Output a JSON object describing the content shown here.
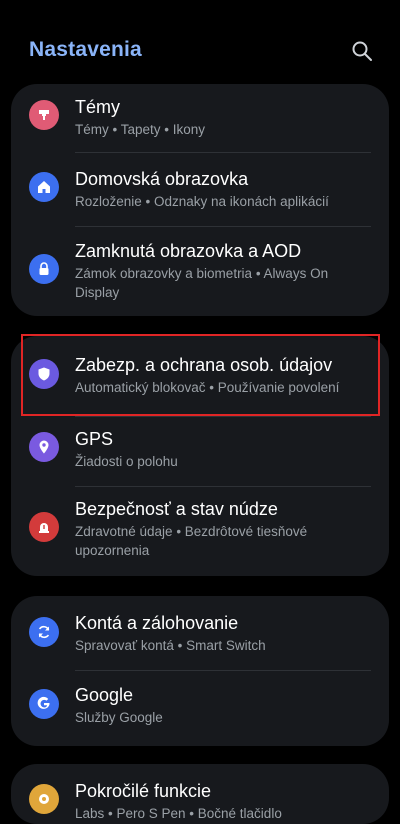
{
  "header": {
    "title": "Nastavenia",
    "search_icon": "search-icon"
  },
  "colors": {
    "accent": "#8ab4f8",
    "highlight": "#e02525"
  },
  "cards": [
    {
      "items": [
        {
          "title": "Témy",
          "subtitle": "Témy  •  Tapety  •  Ikony",
          "icon": "palette-icon",
          "color": "#e05b75"
        },
        {
          "title": "Domovská obrazovka",
          "subtitle": "Rozloženie  •  Odznaky na ikonách aplikácií",
          "icon": "home-icon",
          "color": "#3c6ff0"
        },
        {
          "title": "Zamknutá obrazovka a AOD",
          "subtitle": "Zámok obrazovky a biometria  •  Always On Display",
          "icon": "lock-icon",
          "color": "#3c6ff0"
        }
      ]
    },
    {
      "items": [
        {
          "title": "Zabezp. a ochrana osob. údajov",
          "subtitle": "Automatický blokovač  •  Používanie povolení",
          "icon": "shield-icon",
          "color": "#6b5ae0"
        },
        {
          "title": "GPS",
          "subtitle": "Žiadosti o polohu",
          "icon": "location-pin-icon",
          "color": "#7a5ae0"
        },
        {
          "title": "Bezpečnosť a stav núdze",
          "subtitle": "Zdravotné údaje  •  Bezdrôtové tiesňové upozornenia",
          "icon": "emergency-icon",
          "color": "#d33b3b"
        }
      ]
    },
    {
      "items": [
        {
          "title": "Kontá a zálohovanie",
          "subtitle": "Spravovať kontá  •  Smart Switch",
          "icon": "sync-icon",
          "color": "#3c6ff0"
        },
        {
          "title": "Google",
          "subtitle": "Služby Google",
          "icon": "google-icon",
          "color": "#3c6ff0"
        }
      ]
    },
    {
      "items": [
        {
          "title": "Pokročilé funkcie",
          "subtitle": "Labs  •  Pero S Pen  •  Bočné tlačidlo",
          "icon": "gear-star-icon",
          "color": "#e0a63a"
        }
      ]
    }
  ]
}
